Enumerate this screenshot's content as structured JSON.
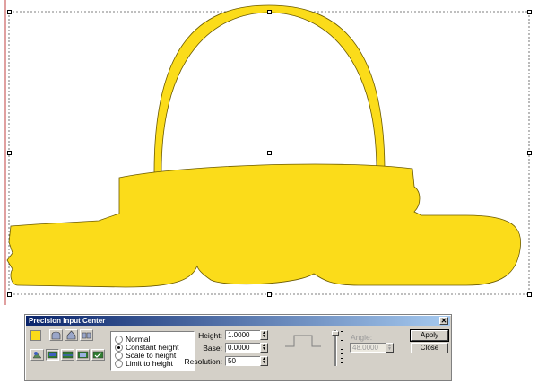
{
  "panel": {
    "title": "Precision Input Center",
    "close_glyph": "✕",
    "colors": {
      "shape_fill": "#fbdc1a",
      "titlebar_start": "#0a246a",
      "titlebar_end": "#a6caf0",
      "window_face": "#d4d0c8"
    },
    "toolbar_icons": [
      "color-swatch-icon",
      "arch-normal-icon",
      "arch-peak-icon",
      "columns-icon",
      "layer-tool-1-icon",
      "layer-tool-2-icon",
      "layer-tool-3-icon",
      "layer-tool-4-icon",
      "layer-tool-5-icon"
    ],
    "modes": [
      {
        "label": "Normal",
        "selected": false
      },
      {
        "label": "Constant height",
        "selected": true
      },
      {
        "label": "Scale to height",
        "selected": false
      },
      {
        "label": "Limit to height",
        "selected": false
      }
    ],
    "fields": {
      "height": {
        "label": "Height:",
        "value": "1.0000"
      },
      "base": {
        "label": "Base:",
        "value": "0.0000"
      },
      "resolution": {
        "label": "Resolution:",
        "value": "50"
      }
    },
    "angle": {
      "label": "Angle:",
      "value": "48.0000",
      "enabled": false
    },
    "buttons": {
      "apply": "Apply",
      "close": "Close"
    }
  }
}
